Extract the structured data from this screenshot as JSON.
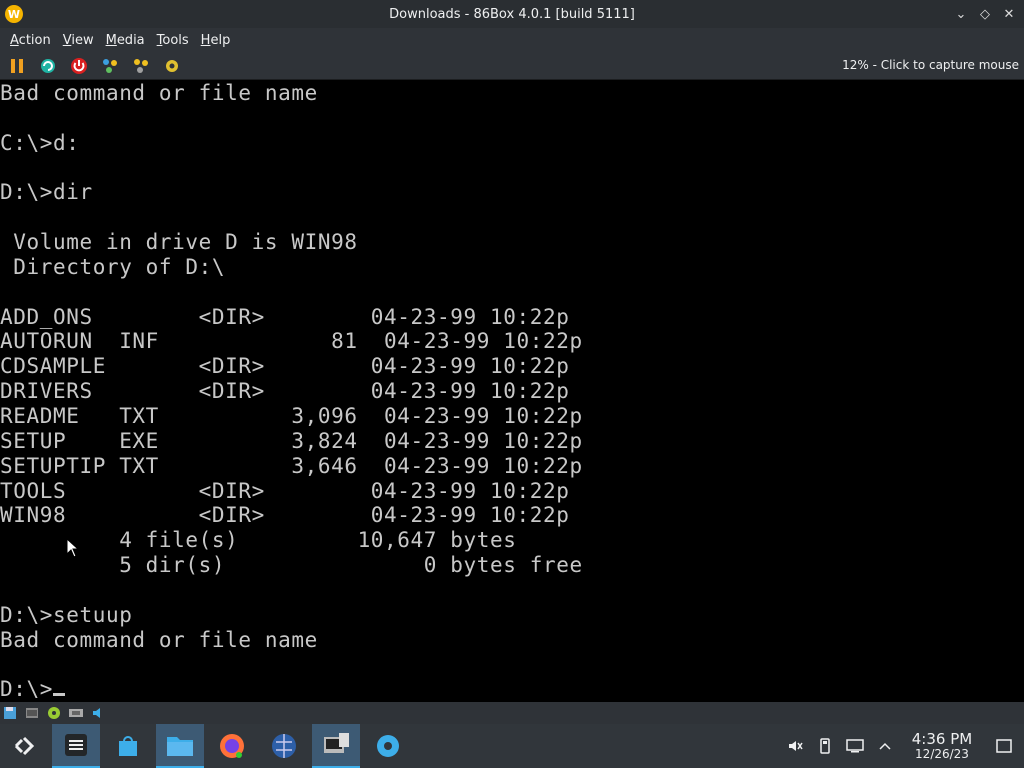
{
  "window": {
    "title": "Downloads - 86Box 4.0.1 [build 5111]",
    "app_icon_letter": "W",
    "minimize_glyph": "⌄",
    "maximize_glyph": "◇",
    "close_glyph": "✕"
  },
  "menubar": {
    "items": [
      {
        "u": "A",
        "rest": "ction"
      },
      {
        "u": "V",
        "rest": "iew"
      },
      {
        "u": "M",
        "rest": "edia"
      },
      {
        "u": "T",
        "rest": "ools"
      },
      {
        "u": "H",
        "rest": "elp"
      }
    ]
  },
  "toolbar": {
    "capture_status": "12% - Click to capture mouse",
    "buttons": [
      "pause-icon",
      "reset-icon",
      "power-icon",
      "ctrl-alt-del-icon",
      "ctrl-alt-esc-icon",
      "settings-icon"
    ]
  },
  "screen": {
    "lines": [
      "Bad command or file name",
      "",
      "C:\\>d:",
      "",
      "D:\\>dir",
      "",
      " Volume in drive D is WIN98",
      " Directory of D:\\",
      "",
      "ADD_ONS        <DIR>        04-23-99 10:22p",
      "AUTORUN  INF             81  04-23-99 10:22p",
      "CDSAMPLE       <DIR>        04-23-99 10:22p",
      "DRIVERS        <DIR>        04-23-99 10:22p",
      "README   TXT          3,096  04-23-99 10:22p",
      "SETUP    EXE          3,824  04-23-99 10:22p",
      "SETUPTIP TXT          3,646  04-23-99 10:22p",
      "TOOLS          <DIR>        04-23-99 10:22p",
      "WIN98          <DIR>        04-23-99 10:22p",
      "         4 file(s)         10,647 bytes",
      "         5 dir(s)               0 bytes free",
      "",
      "D:\\>setuup",
      "Bad command or file name",
      "",
      "D:\\>"
    ]
  },
  "statusbar": {
    "icons": [
      "floppy-icon",
      "hard-disk-icon",
      "cdrom-icon",
      "network-icon",
      "sound-icon"
    ]
  },
  "taskbar": {
    "apps": [
      "application-launcher-icon",
      "system-settings-icon",
      "discover-store-icon",
      "file-manager-icon",
      "firefox-icon",
      "network-browser-icon",
      "86box-icon",
      "settings-gear-icon"
    ],
    "clock_time": "4:36 PM",
    "clock_date": "12/26/23"
  },
  "colors": {
    "titlebar_bg": "#2a2e32",
    "toolbar_bg": "#2f3338",
    "screen_text": "#c8c8c8",
    "taskbar_bg": "#31363b",
    "accent": "#3daee9"
  }
}
